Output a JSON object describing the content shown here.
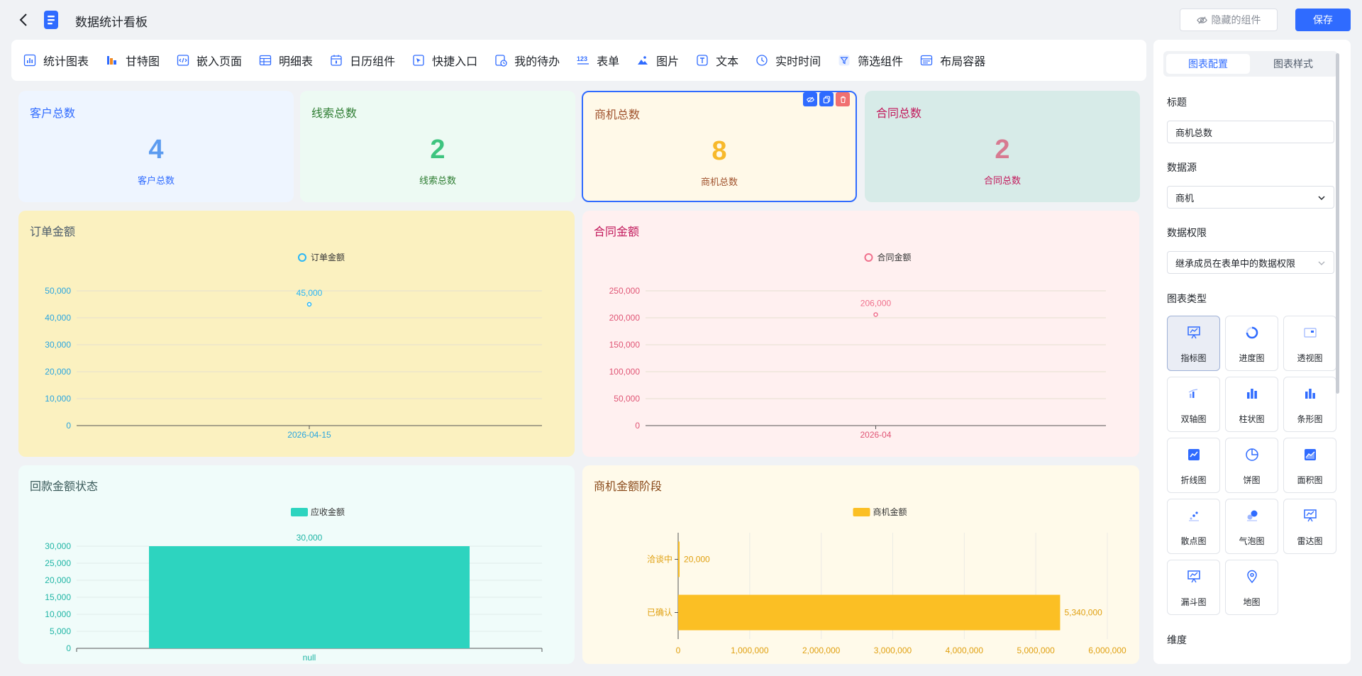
{
  "header": {
    "title": "数据统计看板",
    "hidden_btn": "隐藏的组件",
    "save_btn": "保存"
  },
  "toolbar": {
    "items": [
      {
        "label": "统计图表",
        "icon": "bar-chart-icon"
      },
      {
        "label": "甘特图",
        "icon": "gantt-icon"
      },
      {
        "label": "嵌入页面",
        "icon": "embed-code-icon"
      },
      {
        "label": "明细表",
        "icon": "table-icon"
      },
      {
        "label": "日历组件",
        "icon": "calendar-icon"
      },
      {
        "label": "快捷入口",
        "icon": "shortcut-icon"
      },
      {
        "label": "我的待办",
        "icon": "todo-icon"
      },
      {
        "label": "表单",
        "icon": "form-123-icon"
      },
      {
        "label": "图片",
        "icon": "image-icon"
      },
      {
        "label": "文本",
        "icon": "text-icon"
      },
      {
        "label": "实时时间",
        "icon": "clock-icon"
      },
      {
        "label": "筛选组件",
        "icon": "filter-icon"
      },
      {
        "label": "布局容器",
        "icon": "layout-container-icon"
      }
    ]
  },
  "stats": [
    {
      "label": "客户总数",
      "value": "4",
      "sub": "客户总数",
      "bg": "#eef5ff",
      "color": "#5b9bf0",
      "label_color": "#2f6bff"
    },
    {
      "label": "线索总数",
      "value": "2",
      "sub": "线索总数",
      "bg": "#edfaf3",
      "color": "#3ec47f",
      "label_color": "#2e7d32"
    },
    {
      "label": "商机总数",
      "value": "8",
      "sub": "商机总数",
      "bg": "#fff9e8",
      "color": "#f7b92b",
      "label_color": "#a0522d"
    },
    {
      "label": "合同总数",
      "value": "2",
      "sub": "合同总数",
      "bg": "#d7ebe8",
      "color": "#d77a91",
      "label_color": "#c2185b"
    }
  ],
  "cards": {
    "order": {
      "title": "订单金额"
    },
    "contract": {
      "title": "合同金额"
    },
    "payment": {
      "title": "回款金额状态"
    },
    "opportunity": {
      "title": "商机金额阶段"
    }
  },
  "chart_data": [
    {
      "type": "line",
      "title": "订单金额",
      "series": [
        {
          "name": "订单金额",
          "values": [
            45000
          ]
        }
      ],
      "x": [
        "2026-04-15"
      ],
      "ylim": [
        0,
        50000
      ],
      "yticks": [
        "0",
        "10,000",
        "20,000",
        "30,000",
        "40,000",
        "50,000"
      ],
      "data_labels": [
        "45,000"
      ],
      "color": "#29b6f6",
      "legend": "top-center",
      "grid": true
    },
    {
      "type": "line",
      "title": "合同金额",
      "series": [
        {
          "name": "合同金额",
          "values": [
            206000
          ]
        }
      ],
      "x": [
        "2026-04"
      ],
      "ylim": [
        0,
        250000
      ],
      "yticks": [
        "0",
        "50,000",
        "100,000",
        "150,000",
        "200,000",
        "250,000"
      ],
      "data_labels": [
        "206,000"
      ],
      "color": "#f0708c",
      "legend": "top-center",
      "grid": true
    },
    {
      "type": "bar",
      "title": "回款金额状态",
      "series": [
        {
          "name": "应收金额",
          "values": [
            30000
          ]
        }
      ],
      "categories": [
        "null"
      ],
      "ylim": [
        0,
        30000
      ],
      "yticks": [
        "0",
        "5,000",
        "10,000",
        "15,000",
        "20,000",
        "25,000",
        "30,000"
      ],
      "data_labels": [
        "30,000"
      ],
      "color": "#2dd4bf",
      "legend": "top-center",
      "grid": true
    },
    {
      "type": "bar",
      "orientation": "horizontal",
      "title": "商机金额阶段",
      "series": [
        {
          "name": "商机金额",
          "values": [
            20000,
            5340000
          ]
        }
      ],
      "categories": [
        "洽谈中",
        "已确认"
      ],
      "xlim": [
        0,
        6000000
      ],
      "xticks": [
        "0",
        "1,000,000",
        "2,000,000",
        "3,000,000",
        "4,000,000",
        "5,000,000",
        "6,000,000"
      ],
      "data_labels": [
        "20,000",
        "5,340,000"
      ],
      "color": "#fbbf24",
      "legend": "top-center",
      "grid": true
    }
  ],
  "panel": {
    "tab_config": "图表配置",
    "tab_style": "图表样式",
    "title_label": "标题",
    "title_value": "商机总数",
    "source_label": "数据源",
    "source_value": "商机",
    "perm_label": "数据权限",
    "perm_value": "继承成员在表单中的数据权限",
    "type_label": "图表类型",
    "chart_types": [
      {
        "label": "指标图",
        "icon": "indicator-chart-icon",
        "selected": true
      },
      {
        "label": "进度图",
        "icon": "progress-ring-icon"
      },
      {
        "label": "透视图",
        "icon": "pivot-chart-icon"
      },
      {
        "label": "双轴图",
        "icon": "dual-axis-chart-icon"
      },
      {
        "label": "柱状图",
        "icon": "column-chart-icon"
      },
      {
        "label": "条形图",
        "icon": "bar-chart-icon"
      },
      {
        "label": "折线图",
        "icon": "line-chart-icon"
      },
      {
        "label": "饼图",
        "icon": "pie-chart-icon"
      },
      {
        "label": "面积图",
        "icon": "area-chart-icon"
      },
      {
        "label": "散点图",
        "icon": "scatter-chart-icon"
      },
      {
        "label": "气泡图",
        "icon": "bubble-chart-icon"
      },
      {
        "label": "雷达图",
        "icon": "radar-chart-icon"
      },
      {
        "label": "漏斗图",
        "icon": "funnel-chart-icon"
      },
      {
        "label": "地图",
        "icon": "map-pin-icon"
      }
    ],
    "dimension_label": "维度"
  }
}
